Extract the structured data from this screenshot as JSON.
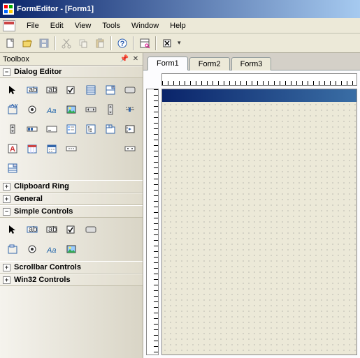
{
  "title": "FormEditor - [Form1]",
  "menu": {
    "file": "File",
    "edit": "Edit",
    "view": "View",
    "tools": "Tools",
    "window": "Window",
    "help": "Help"
  },
  "toolbox": {
    "title": "Toolbox",
    "sections": {
      "dialog_editor": "Dialog Editor",
      "clipboard_ring": "Clipboard Ring",
      "general": "General",
      "simple_controls": "Simple Controls",
      "scrollbar_controls": "Scrollbar Controls",
      "win32_controls": "Win32 Controls"
    }
  },
  "tabs": [
    "Form1",
    "Form2",
    "Form3"
  ],
  "active_tab": 0,
  "colors": {
    "title_start": "#0a246a",
    "title_end": "#a6caf0",
    "face": "#ece9d8"
  }
}
